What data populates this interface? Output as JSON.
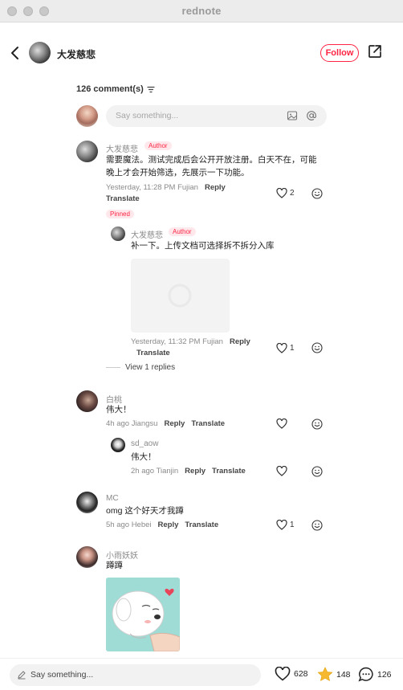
{
  "window": {
    "title": "rednote"
  },
  "header": {
    "author_name": "大发慈悲",
    "follow_label": "Follow"
  },
  "comments_header": {
    "count_label": "126 comment(s)"
  },
  "top_input": {
    "placeholder": "Say something..."
  },
  "comments": [
    {
      "username": "大发慈悲",
      "badge": "Author",
      "text_line1": "需要魔法。测试完成后会公开开放注册。白天不在，可能",
      "text_line2": "晚上才会开始筛选，先展示一下功能。",
      "meta": "Yesterday, 11:28 PM Fujian",
      "reply_label": "Reply",
      "translate_label": "Translate",
      "likes": "2",
      "pinned_label": "Pinned"
    },
    {
      "username": "大发慈悲",
      "badge": "Author",
      "text": "补一下。上传文档可选择拆不拆分入库",
      "meta": "Yesterday, 11:32 PM Fujian",
      "reply_label": "Reply",
      "translate_label": "Translate",
      "likes": "1",
      "view_replies": "View 1 replies"
    },
    {
      "username": "白桃",
      "text": "伟大！",
      "meta": "4h ago Jiangsu",
      "reply_label": "Reply",
      "translate_label": "Translate"
    },
    {
      "username": "sd_aow",
      "text": "伟大！",
      "meta": "2h ago Tianjin",
      "reply_label": "Reply",
      "translate_label": "Translate"
    },
    {
      "username": "MC",
      "text": "omg 这个好天才我蹲",
      "meta": "5h ago Hebei",
      "reply_label": "Reply",
      "translate_label": "Translate",
      "likes": "1"
    },
    {
      "username": "小雨妖妖",
      "text": "蹲蹲"
    }
  ],
  "bottom_bar": {
    "input_label": "Say something...",
    "likes": "628",
    "stars": "148",
    "comments": "126"
  },
  "colors": {
    "accent": "#ff2442",
    "star": "#f5b82e"
  },
  "icons": [
    "back-icon",
    "share-icon",
    "sort-icon",
    "image-icon",
    "at-icon",
    "heart-icon",
    "emoji-icon",
    "pen-icon",
    "star-icon",
    "comment-bubble-icon"
  ]
}
